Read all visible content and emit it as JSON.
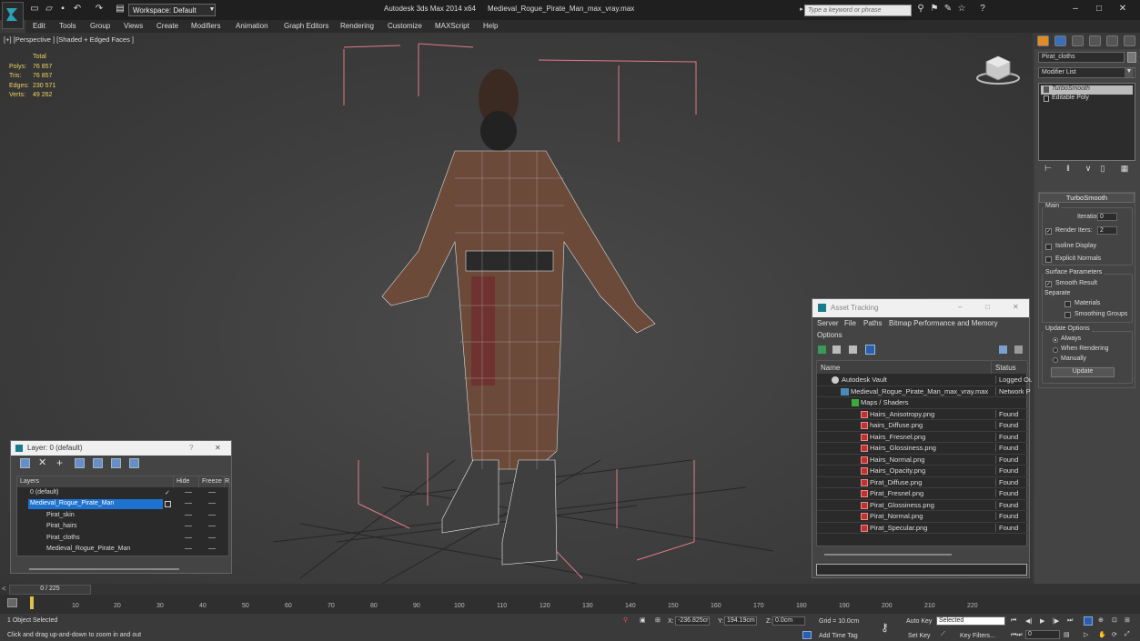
{
  "app": {
    "title": "Autodesk 3ds Max  2014 x64",
    "file": "Medieval_Rogue_Pirate_Man_max_vray.max",
    "workspace": "Workspace: Default",
    "search_placeholder": "Type a keyword or phrase"
  },
  "menu": [
    "Edit",
    "Tools",
    "Group",
    "Views",
    "Create",
    "Modifiers",
    "Animation",
    "Graph Editors",
    "Rendering",
    "Customize",
    "MAXScript",
    "Help"
  ],
  "viewport": {
    "label": "[+] [Perspective ] [Shaded + Edged Faces ]",
    "stats": {
      "header": "Total",
      "rows": [
        {
          "k": "Polys:",
          "v": "76 857"
        },
        {
          "k": "Tris:",
          "v": "76 857"
        },
        {
          "k": "Edges:",
          "v": "230 571"
        },
        {
          "k": "Verts:",
          "v": "49 262"
        }
      ]
    }
  },
  "command_panel": {
    "object_name": "Pirat_cloths",
    "modifier_list": "Modifier List",
    "stack": [
      "TurboSmooth",
      "Editable Poly"
    ],
    "rollout_title": "TurboSmooth",
    "main_label": "Main",
    "iterations_label": "Iterations:",
    "iterations_value": "0",
    "render_iters_label": "Render Iters:",
    "render_iters_value": "2",
    "isoline": "Isoline Display",
    "explicit_normals": "Explicit Normals",
    "surface_params": "Surface Parameters",
    "smooth_result": "Smooth Result",
    "separate": "Separate",
    "materials": "Materials",
    "smoothing_groups": "Smoothing Groups",
    "update_options": "Update Options",
    "always": "Always",
    "when_rendering": "When Rendering",
    "manually": "Manually",
    "update_btn": "Update"
  },
  "layer_dialog": {
    "title": "Layer: 0 (default)",
    "help": "?",
    "close": "✕",
    "col_layers": "Layers",
    "col_hide": "Hide",
    "col_freeze": "Freeze",
    "col_r": "R",
    "rows": [
      {
        "name": "0 (default)",
        "indent": 1
      },
      {
        "name": "Medieval_Rogue_Pirate_Man",
        "indent": 1,
        "selected": true
      },
      {
        "name": "Pirat_skin",
        "indent": 2
      },
      {
        "name": "Pirat_hairs",
        "indent": 2
      },
      {
        "name": "Pirat_cloths",
        "indent": 2
      },
      {
        "name": "Medieval_Rogue_Pirate_Man",
        "indent": 2
      }
    ]
  },
  "asset_tracking": {
    "title": "Asset Tracking",
    "menu": [
      "Server",
      "File",
      "Paths",
      "Bitmap Performance and Memory"
    ],
    "menu2": "Options",
    "col_name": "Name",
    "col_status": "Status",
    "rows": [
      {
        "name": "Autodesk Vault",
        "status": "Logged Ou",
        "indent": 0
      },
      {
        "name": "Medieval_Rogue_Pirate_Man_max_vray.max",
        "status": "Network P",
        "indent": 1
      },
      {
        "name": "Maps / Shaders",
        "status": "",
        "indent": 2
      },
      {
        "name": "Hairs_Anisotropy.png",
        "status": "Found",
        "indent": 3
      },
      {
        "name": "hairs_Diffuse.png",
        "status": "Found",
        "indent": 3
      },
      {
        "name": "Hairs_Fresnel.png",
        "status": "Found",
        "indent": 3
      },
      {
        "name": "Hairs_Glossiness.png",
        "status": "Found",
        "indent": 3
      },
      {
        "name": "Hairs_Normal.png",
        "status": "Found",
        "indent": 3
      },
      {
        "name": "Hairs_Opacity.png",
        "status": "Found",
        "indent": 3
      },
      {
        "name": "Pirat_Diffuse.png",
        "status": "Found",
        "indent": 3
      },
      {
        "name": "Pirat_Fresnel.png",
        "status": "Found",
        "indent": 3
      },
      {
        "name": "Pirat_Glossiness.png",
        "status": "Found",
        "indent": 3
      },
      {
        "name": "Pirat_Normal.png",
        "status": "Found",
        "indent": 3
      },
      {
        "name": "Pirat_Specular.png",
        "status": "Found",
        "indent": 3
      }
    ]
  },
  "timeline": {
    "slider": "0 / 225",
    "ticks": [
      "0",
      "10",
      "20",
      "30",
      "40",
      "50",
      "60",
      "70",
      "80",
      "90",
      "100",
      "110",
      "120",
      "130",
      "140",
      "150",
      "160",
      "170",
      "180",
      "190",
      "200",
      "210",
      "220"
    ]
  },
  "status": {
    "selected": "1 Object Selected",
    "prompt": "Click and drag up-and-down to zoom in and out",
    "x_label": "X:",
    "x_value": "-236.825cr",
    "y_label": "Y:",
    "y_value": "194.19cm",
    "z_label": "Z:",
    "z_value": "0.0cm",
    "grid": "Grid = 10.0cm",
    "add_time_tag": "Add Time Tag",
    "auto_key": "Auto Key",
    "auto_key_value": "Selected",
    "set_key": "Set Key",
    "key_filters": "Key Filters...",
    "frame": "0"
  }
}
